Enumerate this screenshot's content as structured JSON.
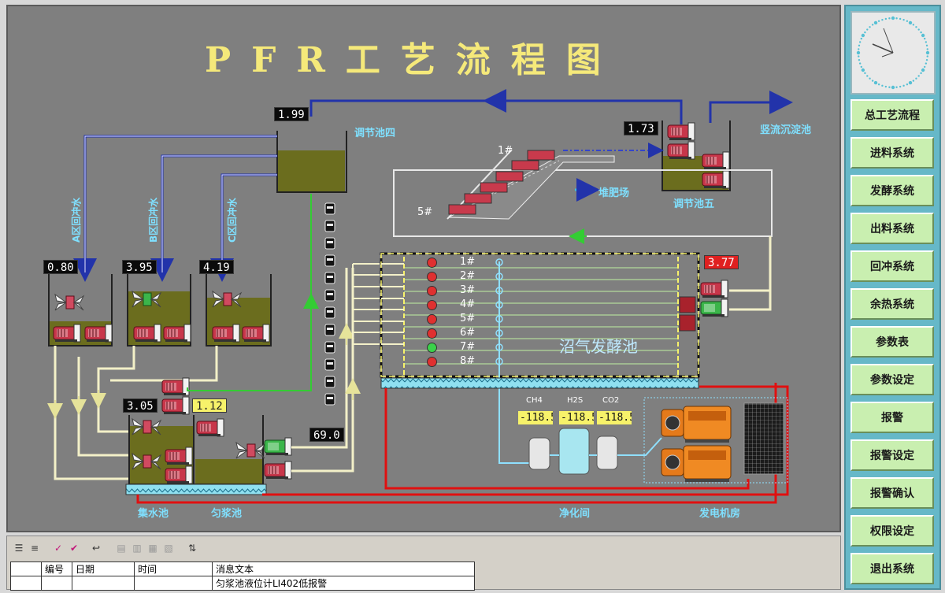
{
  "title": "PFR工艺流程图",
  "tanks": {
    "t4": {
      "label": "调节池四",
      "level": "1.99"
    },
    "t5": {
      "label": "调节池五",
      "level": "1.73"
    },
    "a": {
      "level": "0.80"
    },
    "b": {
      "level": "3.95"
    },
    "c": {
      "level": "4.19"
    },
    "collect": {
      "label": "集水池",
      "level": "3.05"
    },
    "mix": {
      "label": "匀浆池",
      "level": "1.12"
    },
    "digester": {
      "label": "沼气发酵池",
      "level": "3.77"
    }
  },
  "flow_labels": {
    "a_backflush": "A区回冲水",
    "b_backflush": "B区回冲水",
    "c_backflush": "C区回冲水",
    "settling": "竖流沉淀池",
    "compost": "堆肥场",
    "conveyor_top": "1#",
    "conveyor_bottom": "5#"
  },
  "pump_flow": "69.0",
  "digester_rows": [
    "1#",
    "2#",
    "3#",
    "4#",
    "5#",
    "6#",
    "7#",
    "8#"
  ],
  "digester_row_status": [
    "red",
    "red",
    "red",
    "red",
    "red",
    "red",
    "green",
    "red"
  ],
  "gas": {
    "ch4": {
      "label": "CH4",
      "value": "-118.5"
    },
    "h2s": {
      "label": "H2S",
      "value": "-118.5"
    },
    "co2": {
      "label": "CO2",
      "value": "-118.5"
    }
  },
  "rooms": {
    "purify": "净化间",
    "generator": "发电机房"
  },
  "nav": {
    "b1": "总工艺流程",
    "b2": "进料系统",
    "b3": "发酵系统",
    "b4": "出料系统",
    "b5": "回冲系统",
    "b6": "余热系统",
    "b7": "参数表",
    "b8": "参数设定",
    "b9": "报警",
    "b10": "报警设定",
    "b11": "报警确认",
    "b12": "权限设定",
    "b13": "退出系统"
  },
  "alarm": {
    "columns": {
      "c1": "编号",
      "c2": "日期",
      "c3": "时间",
      "c4": "消息文本"
    },
    "row1": {
      "c1": "",
      "c2": "",
      "c3": "",
      "c4": "匀浆池液位计LI402低报警"
    }
  },
  "colors": {
    "canvas": "#7f7f7f",
    "liquid": "#6b6d1e",
    "pipe_blue": "#2233aa",
    "pipe_green": "#33cc33",
    "pipe_red": "#e01010",
    "pipe_cream": "#f3f0c8",
    "title": "#f5e97a"
  }
}
